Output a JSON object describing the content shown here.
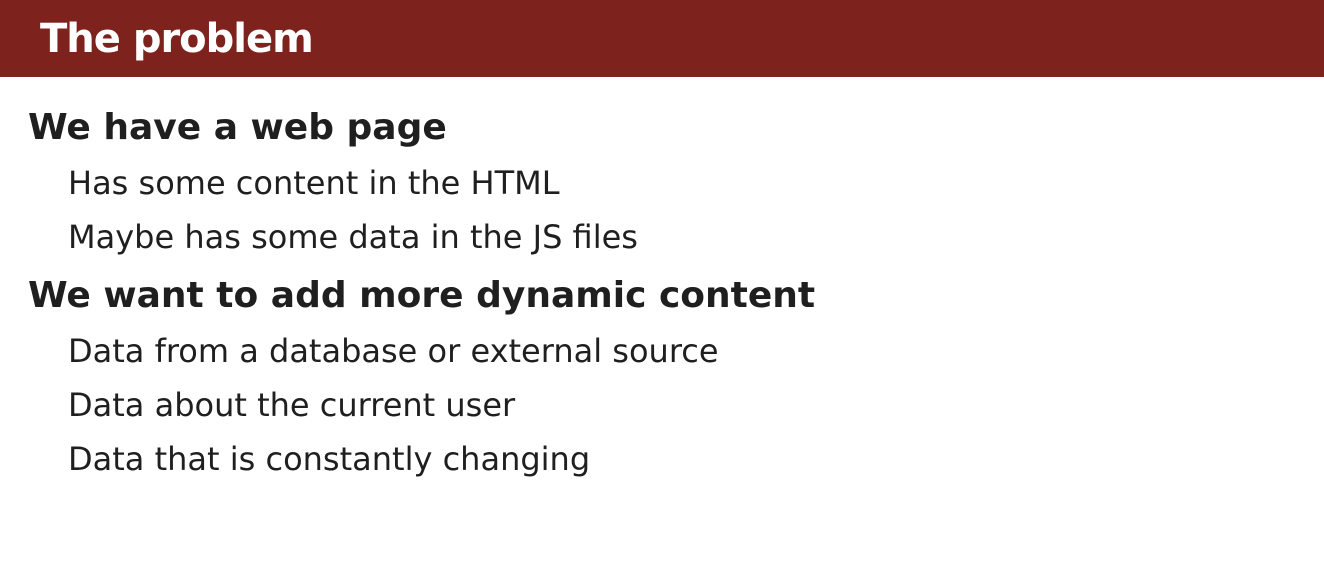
{
  "slide": {
    "title": "The problem",
    "accent_color": "#7e221e",
    "sections": [
      {
        "heading": "We have a web page",
        "items": [
          "Has some content in the HTML",
          "Maybe has some data in the JS files"
        ]
      },
      {
        "heading": "We want to add more dynamic content",
        "items": [
          "Data from a database or external source",
          "Data about the current user",
          "Data that is constantly changing"
        ]
      }
    ]
  }
}
